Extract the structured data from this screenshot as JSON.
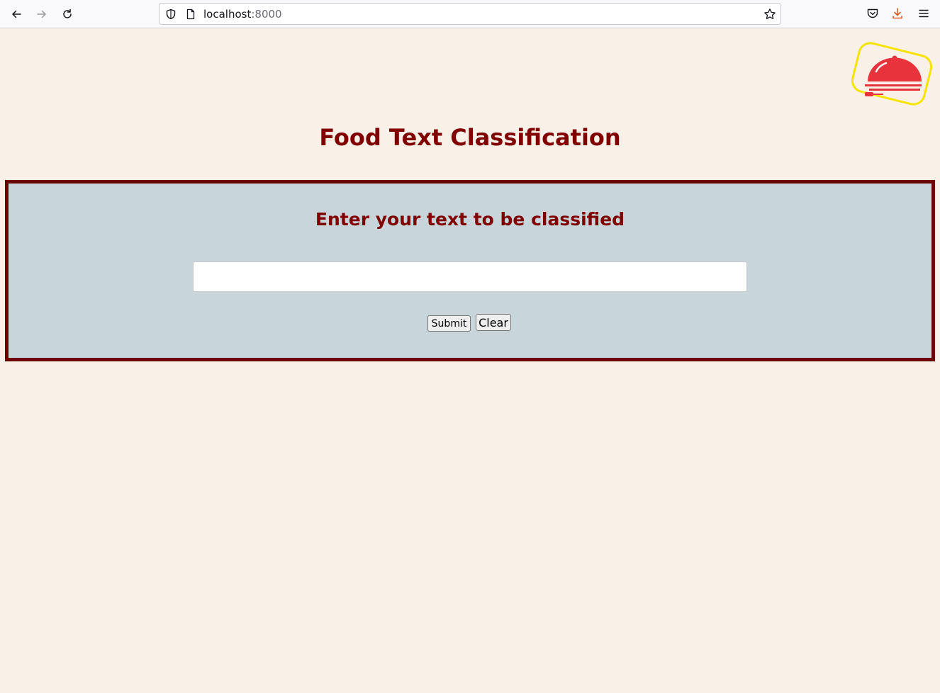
{
  "browser": {
    "url_host": "localhost",
    "url_port": ":8000"
  },
  "page": {
    "title": "Food Text Classification",
    "panel_heading": "Enter your text to be classified",
    "input_value": "",
    "submit_label": "Submit",
    "clear_label": "Clear"
  },
  "colors": {
    "page_background": "#f9f0e7",
    "title_color": "#800000",
    "panel_background": "#c8d5da",
    "panel_border": "#6b0000",
    "logo_red": "#e8323c",
    "logo_yellow": "#f5e400"
  },
  "icons": {
    "back": "arrow-left",
    "forward": "arrow-right",
    "reload": "reload",
    "shield": "tracking-protection-shield",
    "page": "page-document",
    "bookmark": "star",
    "pocket": "pocket",
    "downloads": "download-arrow",
    "menu": "hamburger-menu",
    "logo": "food-cloche"
  }
}
